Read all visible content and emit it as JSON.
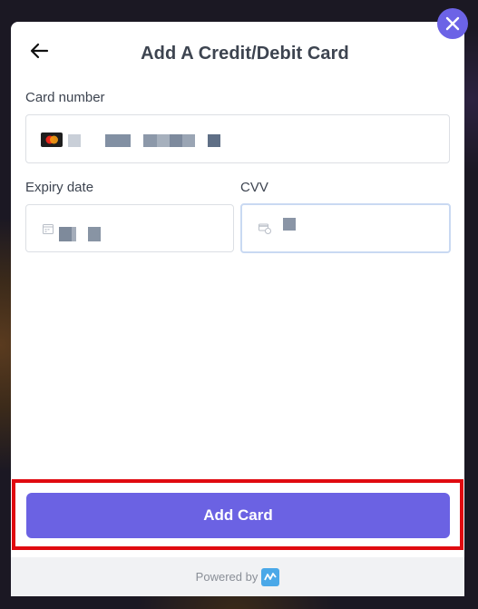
{
  "modal": {
    "title": "Add A Credit/Debit Card"
  },
  "fields": {
    "card_number_label": "Card number",
    "expiry_label": "Expiry date",
    "cvv_label": "CVV"
  },
  "actions": {
    "add_card_label": "Add Card"
  },
  "footer": {
    "powered_by": "Powered by"
  },
  "colors": {
    "accent": "#6b62e3",
    "highlight": "#e00a10"
  },
  "icons": {
    "close": "close-icon",
    "back": "arrow-left-icon",
    "card_brand": "mastercard-icon",
    "calendar": "calendar-icon",
    "cvv": "card-lock-icon",
    "powered_logo": "provider-logo-icon"
  }
}
